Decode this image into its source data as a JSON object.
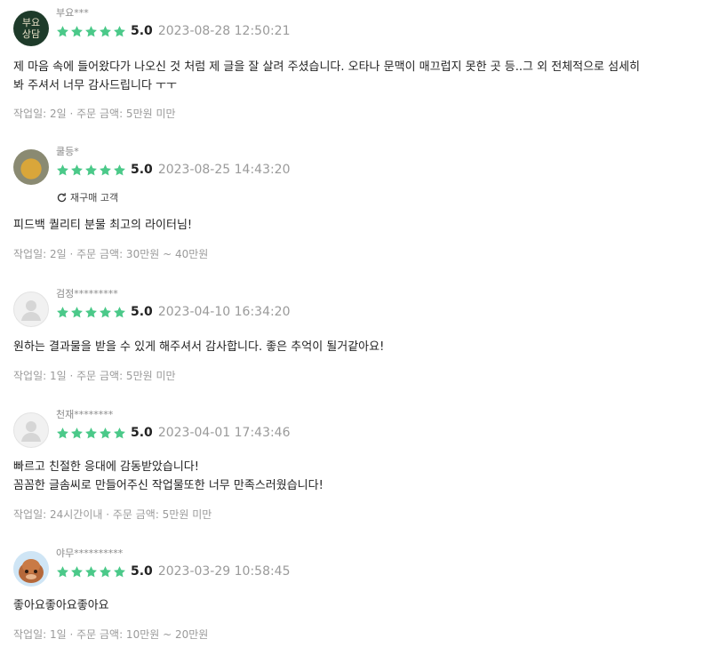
{
  "colors": {
    "star": "#4bc989",
    "meta": "#9a9a9a",
    "avatar_green": "#1e3b2a"
  },
  "reviews": [
    {
      "avatar": {
        "type": "logo",
        "line1": "부요",
        "line2": "상담"
      },
      "name": "부요***",
      "stars": 5,
      "score": "5.0",
      "date": "2023-08-28 12:50:21",
      "text": [
        "제 마음 속에 들어왔다가 나오신 것 처럼 제 글을 잘 살려 주셨습니다. 오타나 문맥이 매끄럽지 못한  곳 등..그 외 전체적으로 섬세히",
        "봐 주셔서 너무 감사드립니다 ㅜㅜ"
      ],
      "meta": "작업일: 2일 · 주문 금액: 5만원 미만"
    },
    {
      "avatar": {
        "type": "photo"
      },
      "name": "쿨등*",
      "stars": 5,
      "score": "5.0",
      "date": "2023-08-25 14:43:20",
      "badge": "재구매 고객",
      "text": [
        "피드백 퀄리티 분물 최고의 라이터님!"
      ],
      "meta": "작업일: 2일 · 주문 금액: 30만원 ~ 40만원"
    },
    {
      "avatar": {
        "type": "default"
      },
      "name": "검정*********",
      "stars": 5,
      "score": "5.0",
      "date": "2023-04-10 16:34:20",
      "text": [
        "원하는 결과물을 받을 수 있게 해주셔서 감사합니다.  좋은 추억이 될거같아요!"
      ],
      "meta": "작업일: 1일 · 주문 금액: 5만원 미만"
    },
    {
      "avatar": {
        "type": "default"
      },
      "name": "천재********",
      "stars": 5,
      "score": "5.0",
      "date": "2023-04-01 17:43:46",
      "text": [
        "빠르고 친절한 응대에 감동받았습니다!",
        "꼼꼼한 글솜씨로 만들어주신 작업물또한 너무 만족스러웠습니다!"
      ],
      "meta": "작업일: 24시간이내 · 주문 금액: 5만원 미만"
    },
    {
      "avatar": {
        "type": "character"
      },
      "name": "야무**********",
      "stars": 5,
      "score": "5.0",
      "date": "2023-03-29 10:58:45",
      "text": [
        "좋아요좋아요좋아요"
      ],
      "meta": "작업일: 1일 · 주문 금액: 10만원 ~ 20만원"
    }
  ]
}
